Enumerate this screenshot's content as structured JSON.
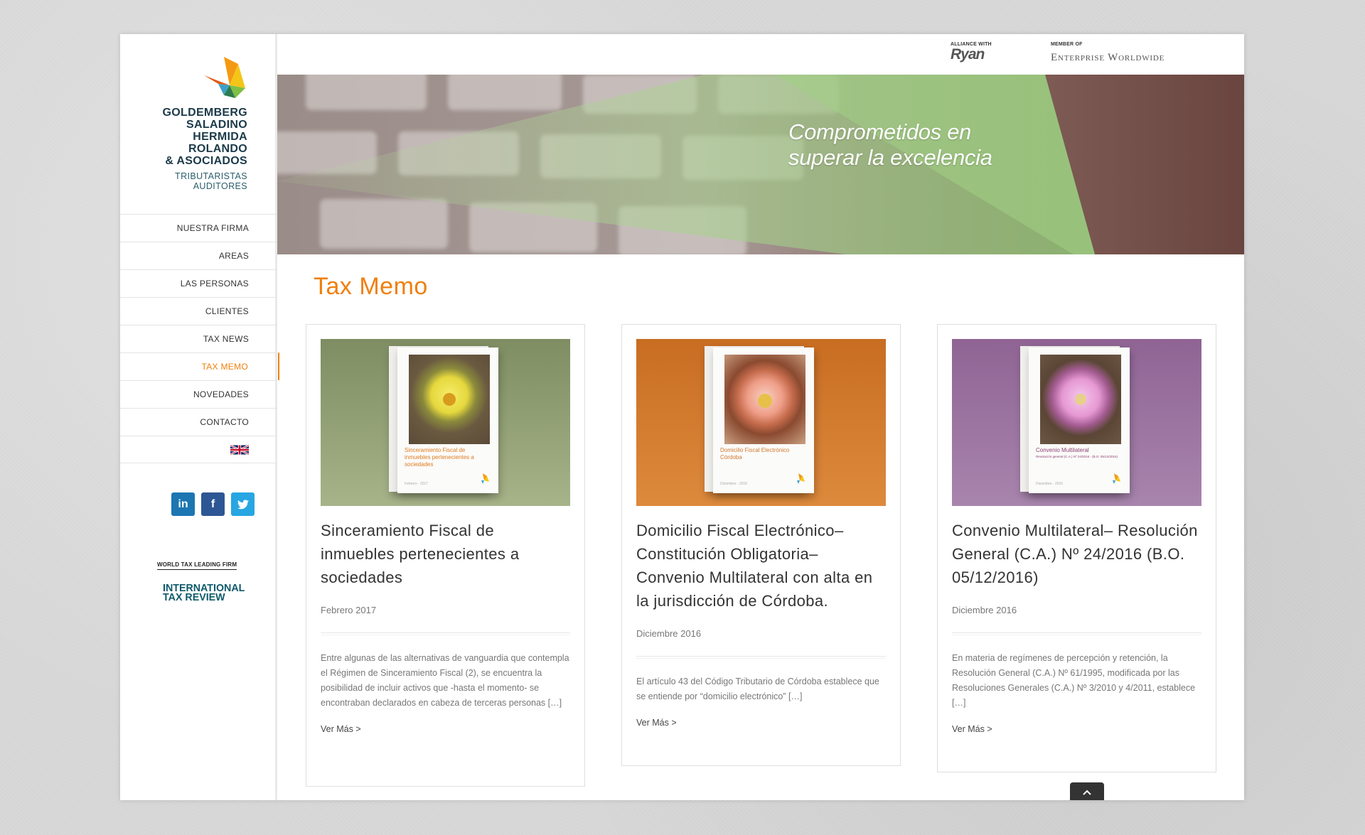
{
  "logo": {
    "name_lines": [
      "GOLDEMBERG",
      "SALADINO",
      "HERMIDA",
      "ROLANDO",
      "& ASOCIADOS"
    ],
    "sub_lines": [
      "TRIBUTARISTAS",
      "AUDITORES"
    ]
  },
  "nav": {
    "items": [
      {
        "label": "NUESTRA FIRMA"
      },
      {
        "label": "AREAS"
      },
      {
        "label": "LAS PERSONAS"
      },
      {
        "label": "CLIENTES"
      },
      {
        "label": "TAX NEWS"
      },
      {
        "label": "TAX MEMO"
      },
      {
        "label": "NOVEDADES"
      },
      {
        "label": "CONTACTO"
      }
    ],
    "active": "TAX MEMO"
  },
  "social": {
    "linkedin": "in",
    "facebook": "f",
    "twitter": "t"
  },
  "badge": {
    "top": "WORLD TAX LEADING FIRM",
    "line1": "INTERNATIONAL",
    "line2": "TAX REVIEW"
  },
  "header": {
    "alliance_label": "ALLIANCE WITH",
    "alliance_brand": "Ryan",
    "member_label": "MEMBER OF",
    "member_brand": "Enterprise Worldwide"
  },
  "banner": {
    "line1": "Comprometidos en",
    "line2": "superar la excelencia"
  },
  "page_title": "Tax Memo",
  "cards": [
    {
      "title": "Sinceramiento Fiscal de inmuebles pertenecientes a sociedades",
      "date": "Febrero 2017",
      "excerpt": "Entre algunas de las alternativas de vanguardia que contempla el Régimen de Sinceramiento Fiscal (2), se encuentra la posibilidad de incluir activos que -hasta el momento- se encontraban declarados en cabeza de terceras personas […]",
      "more": "Ver Más >",
      "book_title": "Sinceramiento Fiscal de inmuebles pertenecientes a sociedades",
      "book_date": "Febrero - 2017",
      "colors": {
        "bg": "#8a9a6e",
        "accent": "#f07f0e",
        "flower": "#f3e65a"
      }
    },
    {
      "title": "Domicilio Fiscal Electrónico– Constitución Obligatoria– Convenio Multilateral con alta en la jurisdicción de Córdoba.",
      "date": "Diciembre 2016",
      "excerpt": "El artículo 43 del Código Tributario de Córdoba establece que se entiende por “domicilio electrónico” […]",
      "more": "Ver Más >",
      "book_title": "Domicilio Fiscal Electrónico Córdoba",
      "book_date": "Diciembre - 2016",
      "colors": {
        "bg": "#d2782c",
        "accent": "#d2782c",
        "flower": "#f4c8bc"
      }
    },
    {
      "title": "Convenio Multilateral– Resolución General (C.A.) Nº 24/2016 (B.O. 05/12/2016)",
      "date": "Diciembre 2016",
      "excerpt": "En materia de regímenes de percepción y retención, la Resolución General (C.A.) Nº 61/1995, modificada por las Resoluciones Generales (C.A.) Nº 3/2010 y 4/2011, establece […]",
      "more": "Ver Más >",
      "book_title": "Convenio Multilateral",
      "book_sub": "Resolución general (C.A.) Nº 24/2016 - (B.O. 05/12/2016)",
      "book_date": "Diciembre - 2016",
      "colors": {
        "bg": "#9a6fa0",
        "accent": "#8e3f6f",
        "flower": "#f2b8e2"
      }
    }
  ]
}
